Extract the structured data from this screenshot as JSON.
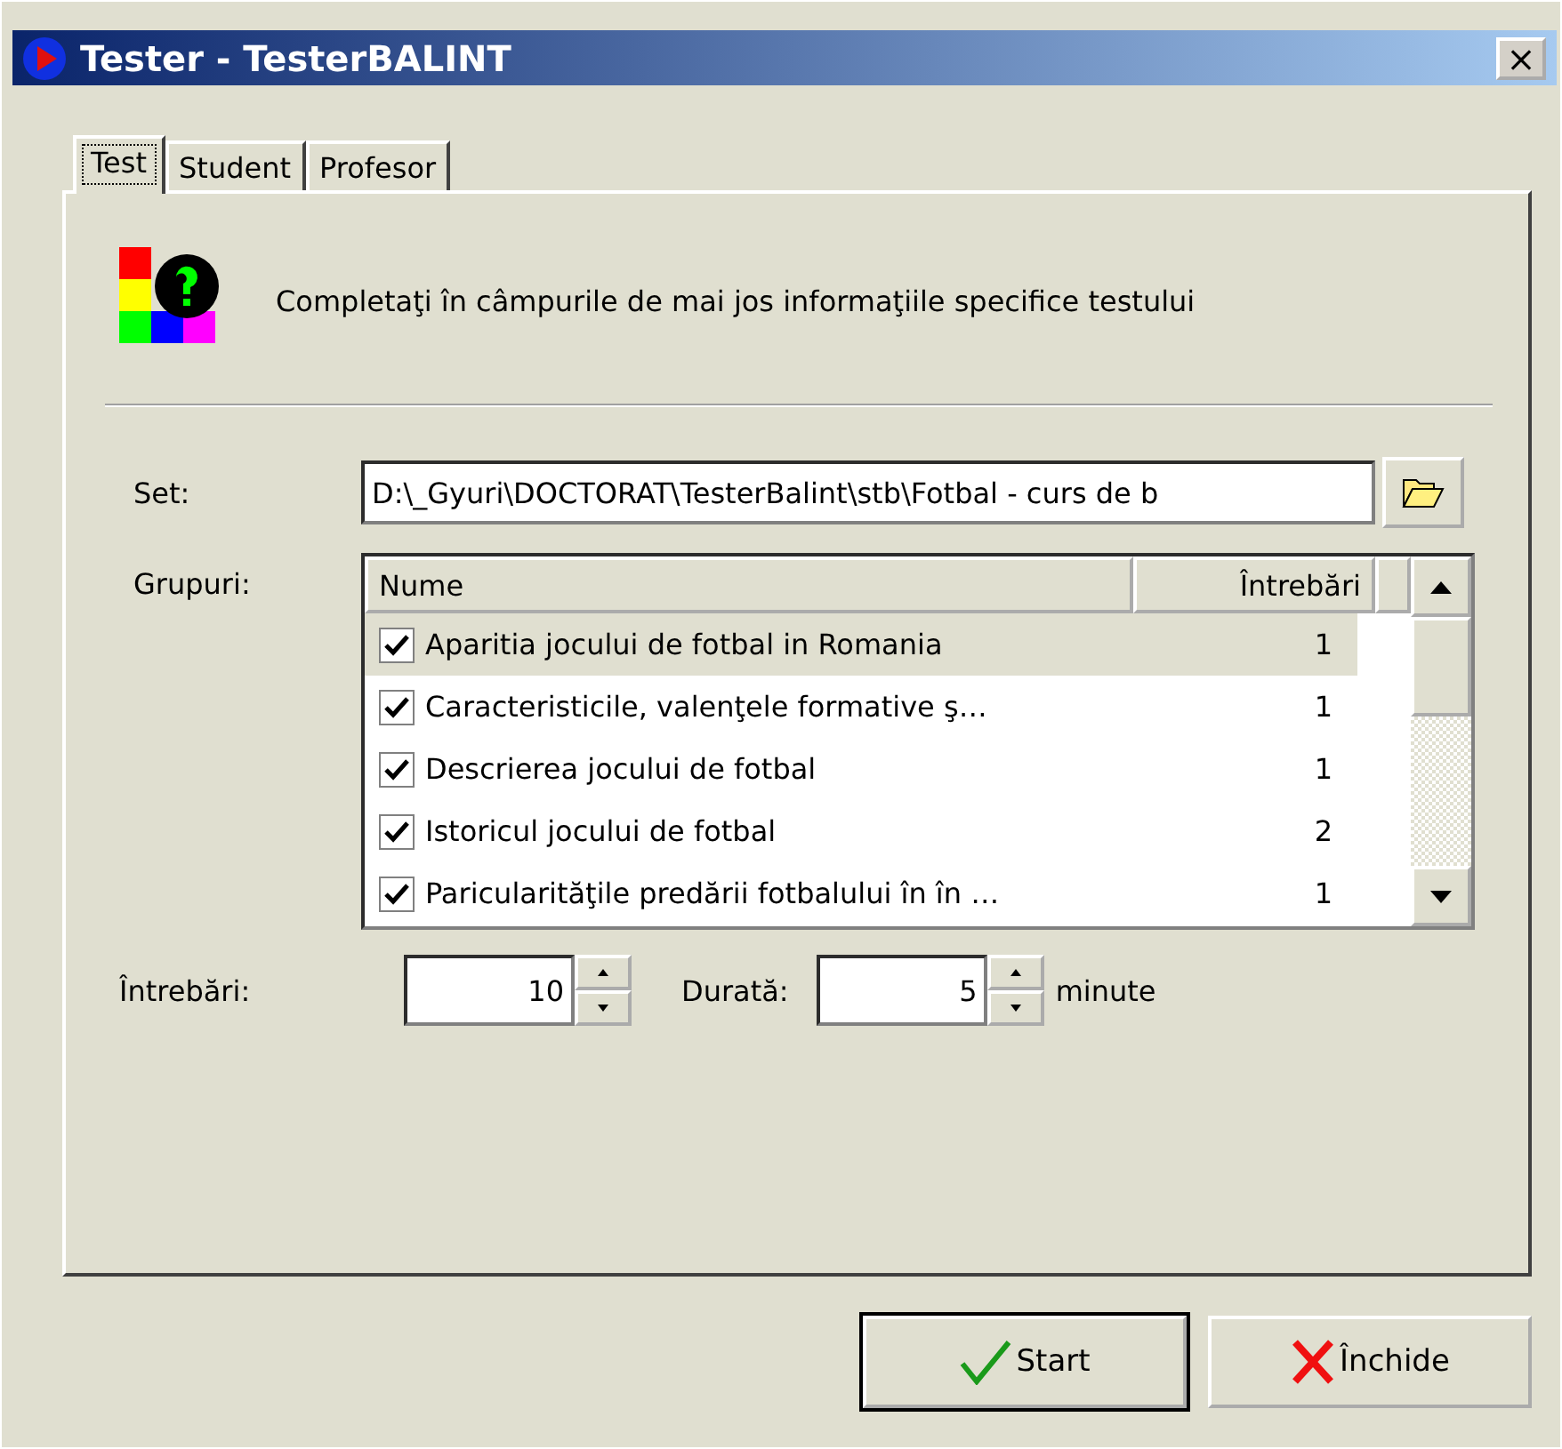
{
  "window": {
    "title": "Tester - TesterBALINT",
    "close": "×"
  },
  "tabs": [
    {
      "label": "Test",
      "selected": true
    },
    {
      "label": "Student",
      "selected": false
    },
    {
      "label": "Profesor",
      "selected": false
    }
  ],
  "intro": "Completaţi în câmpurile de mai jos informaţiile specifice testului",
  "set": {
    "label": "Set:",
    "value": "D:\\_Gyuri\\DOCTORAT\\TesterBalint\\stb\\Fotbal - curs de b"
  },
  "groups": {
    "label": "Grupuri:",
    "columns": [
      "Nume",
      "Întrebări"
    ],
    "rows": [
      {
        "name": "Aparitia jocului de fotbal in Romania",
        "count": "1",
        "checked": true,
        "selected": true
      },
      {
        "name": "Caracteristicile, valenţele formative ş…",
        "count": "1",
        "checked": true,
        "selected": false
      },
      {
        "name": "Descrierea jocului de fotbal",
        "count": "1",
        "checked": true,
        "selected": false
      },
      {
        "name": "Istoricul jocului de fotbal",
        "count": "2",
        "checked": true,
        "selected": false
      },
      {
        "name": "Paricularităţile predării fotbalului în în …",
        "count": "1",
        "checked": true,
        "selected": false
      }
    ]
  },
  "questions": {
    "label": "Întrebări:",
    "value": "10"
  },
  "duration": {
    "label": "Durată:",
    "value": "5",
    "unit": "minute"
  },
  "buttons": [
    {
      "label": "Start",
      "kind": "ok"
    },
    {
      "label": "Închide",
      "kind": "cancel"
    }
  ]
}
